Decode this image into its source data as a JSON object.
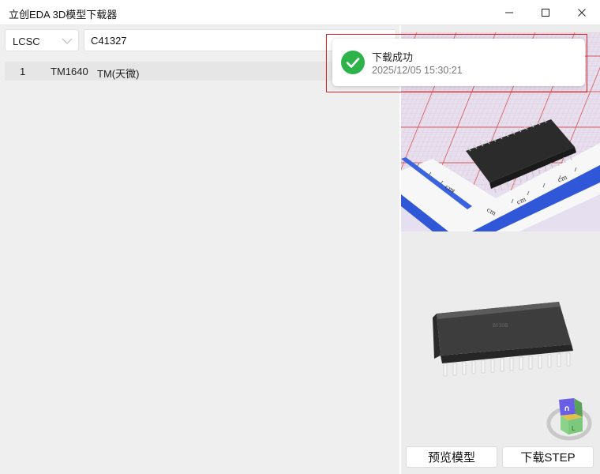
{
  "window": {
    "title": "立创EDA 3D模型下载器"
  },
  "search": {
    "source_value": "LCSC",
    "query": "C41327"
  },
  "results": [
    {
      "index": "1",
      "part": "TM1640",
      "manufacturer": "TM(天微)"
    }
  ],
  "preview": {
    "photo_ruler_label": "cm"
  },
  "buttons": {
    "preview_model": "预览模型",
    "download_step": "下载STEP"
  },
  "toast": {
    "title": "下载成功",
    "time": "2025/12/05 15:30:21"
  },
  "icons": {
    "window_controls": [
      "minimize-icon",
      "maximize-icon",
      "close-icon"
    ],
    "toast": "success-check-icon",
    "select": "chevron-down-icon",
    "viewer": "nav-cube-icon"
  },
  "colors": {
    "success": "#2db34a",
    "highlight": "#e2252b",
    "ruler_blue": "#2f57d8",
    "grid_red": "#d45a5a"
  }
}
